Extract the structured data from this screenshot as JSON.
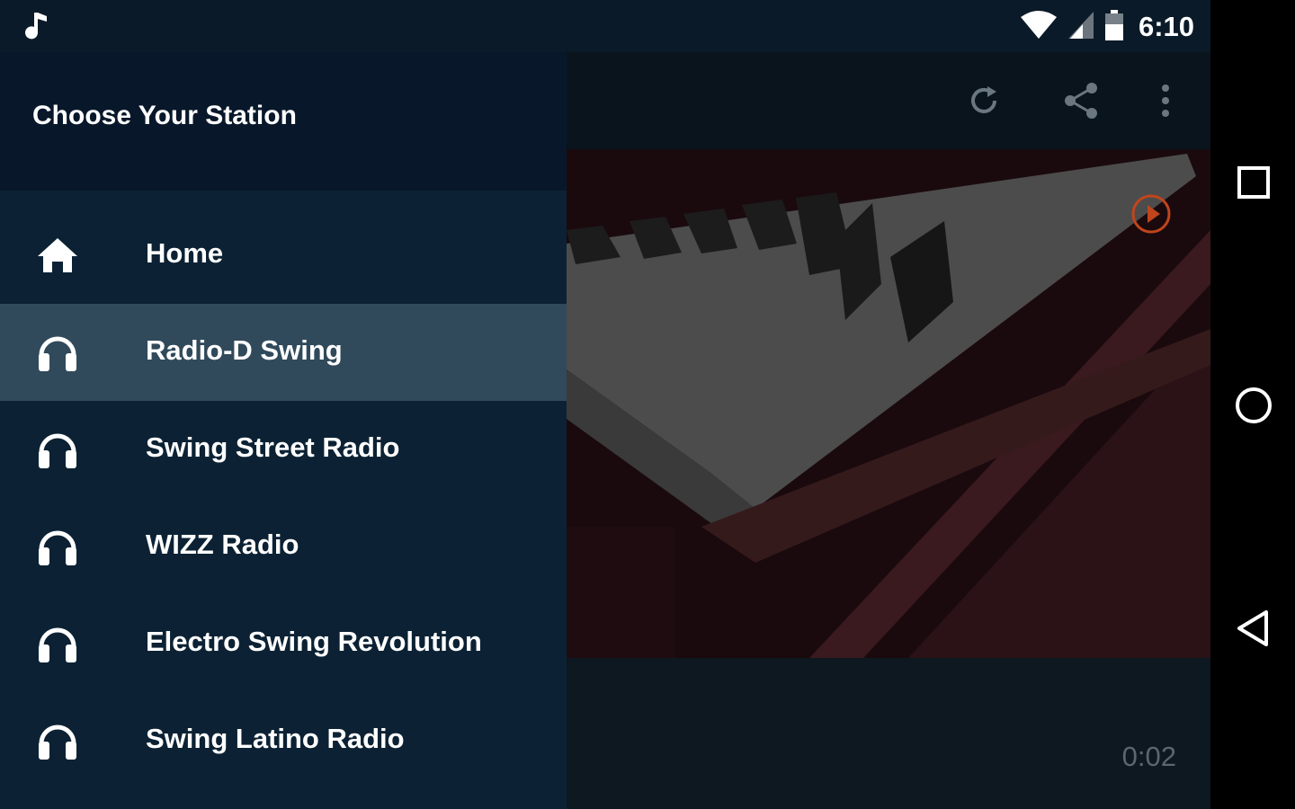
{
  "status_bar": {
    "time": "6:10",
    "icons": [
      "music-note-icon",
      "wifi-icon",
      "cell-signal-icon",
      "battery-icon"
    ]
  },
  "drawer": {
    "title": "Choose Your Station",
    "items": [
      {
        "label": "Home",
        "icon": "home-icon",
        "active": false
      },
      {
        "label": "Radio-D Swing",
        "icon": "headphones-icon",
        "active": true
      },
      {
        "label": "Swing Street Radio",
        "icon": "headphones-icon",
        "active": false
      },
      {
        "label": "WIZZ Radio",
        "icon": "headphones-icon",
        "active": false
      },
      {
        "label": "Electro Swing Revolution",
        "icon": "headphones-icon",
        "active": false
      },
      {
        "label": "Swing Latino Radio",
        "icon": "headphones-icon",
        "active": false
      }
    ]
  },
  "toolbar": {
    "icons": [
      "refresh-icon",
      "share-icon",
      "more-vert-icon"
    ]
  },
  "player": {
    "elapsed": "0:02",
    "accent_color": "#c0451c"
  },
  "nav_bar": {
    "icons": [
      "recents-icon",
      "home-circle-icon",
      "back-icon"
    ]
  },
  "colors": {
    "drawer_bg": "#0c2234",
    "drawer_active": "#304a5b",
    "status_bar_bg": "#0a1a28"
  }
}
